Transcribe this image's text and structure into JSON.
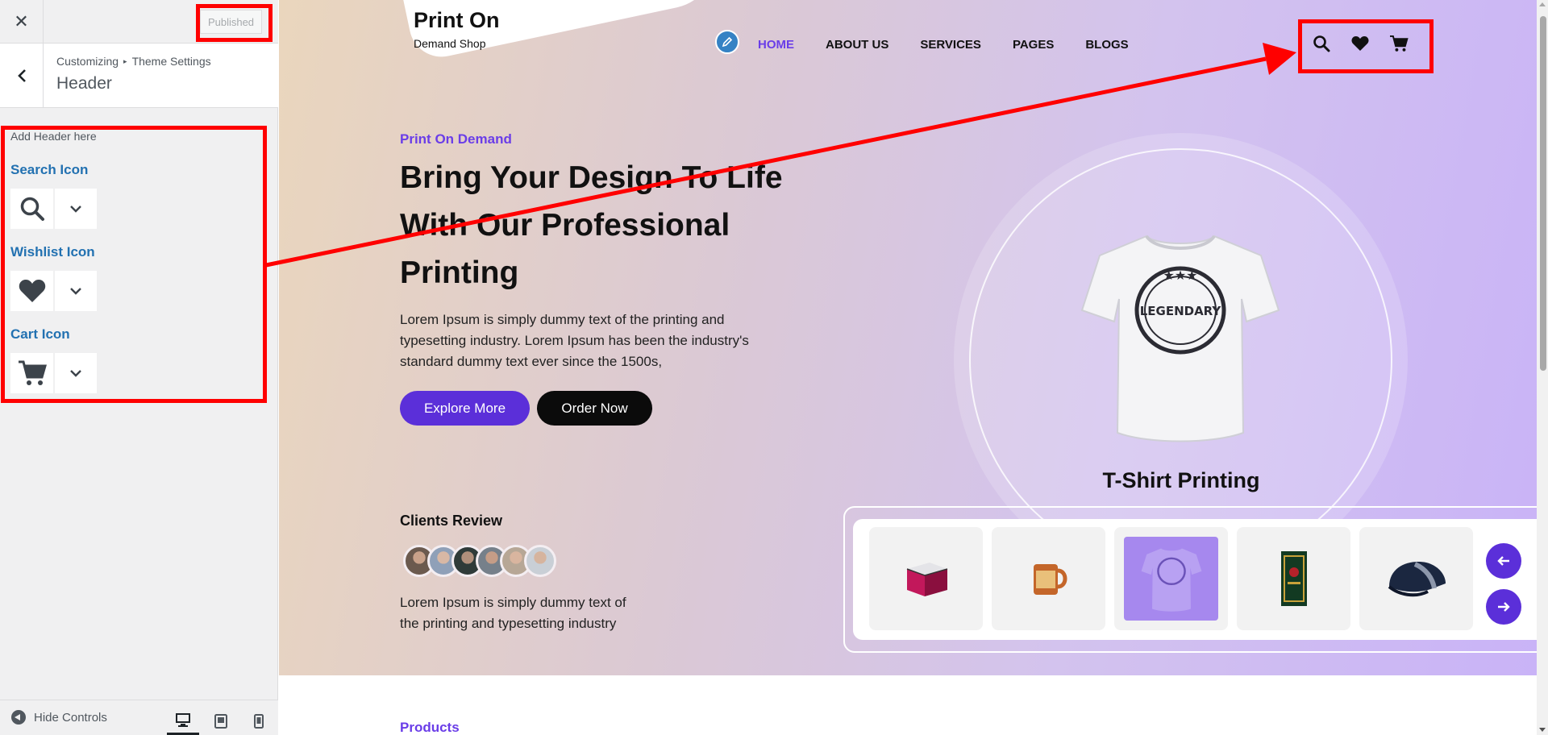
{
  "customizer": {
    "close_glyph": "✕",
    "publish_status": "Published",
    "back_glyph": "‹",
    "breadcrumb": {
      "root": "Customizing",
      "separator": "▸",
      "parent": "Theme Settings"
    },
    "section_title": "Header",
    "section_description": "Add Header here",
    "controls": [
      {
        "label": "Search Icon",
        "icon": "search-icon"
      },
      {
        "label": "Wishlist Icon",
        "icon": "heart-icon"
      },
      {
        "label": "Cart Icon",
        "icon": "cart-icon"
      }
    ],
    "footer": {
      "hide_controls_label": "Hide Controls",
      "devices": [
        "desktop",
        "tablet",
        "mobile"
      ],
      "active_device": "desktop"
    }
  },
  "preview": {
    "logo": {
      "title": "Print On",
      "subtitle": "Demand Shop"
    },
    "nav": [
      "HOME",
      "ABOUT US",
      "SERVICES",
      "PAGES",
      "BLOGS"
    ],
    "nav_active": "HOME",
    "header_icons": [
      "search-icon",
      "heart-icon",
      "cart-icon"
    ],
    "hero": {
      "eyebrow": "Print On Demand",
      "heading_lines": [
        "Bring Your Design To Life",
        "With Our Professional",
        "Printing"
      ],
      "lead_lines": [
        "Lorem Ipsum is simply dummy text of the printing and",
        "typesetting industry. Lorem Ipsum has been the industry's",
        "standard dummy text ever since the 1500s,"
      ],
      "primary_button": "Explore More",
      "secondary_button": "Order Now",
      "featured_product": "T-Shirt Printing",
      "shirt_print": "LEGENDARY"
    },
    "clients": {
      "heading": "Clients Review",
      "avatar_count": 6,
      "text_lines": [
        "Lorem Ipsum is simply dummy text of",
        "the printing and typesetting industry"
      ]
    },
    "carousel_items": [
      "box",
      "mug",
      "t-shirt",
      "book",
      "cap"
    ],
    "carousel_active": 2,
    "next_section_title": "Products"
  },
  "colors": {
    "accent_purple": "#5b2fd9",
    "nav_active": "#6a3de8",
    "wp_link_blue": "#2271b1",
    "annotation_red": "#ff0000"
  }
}
